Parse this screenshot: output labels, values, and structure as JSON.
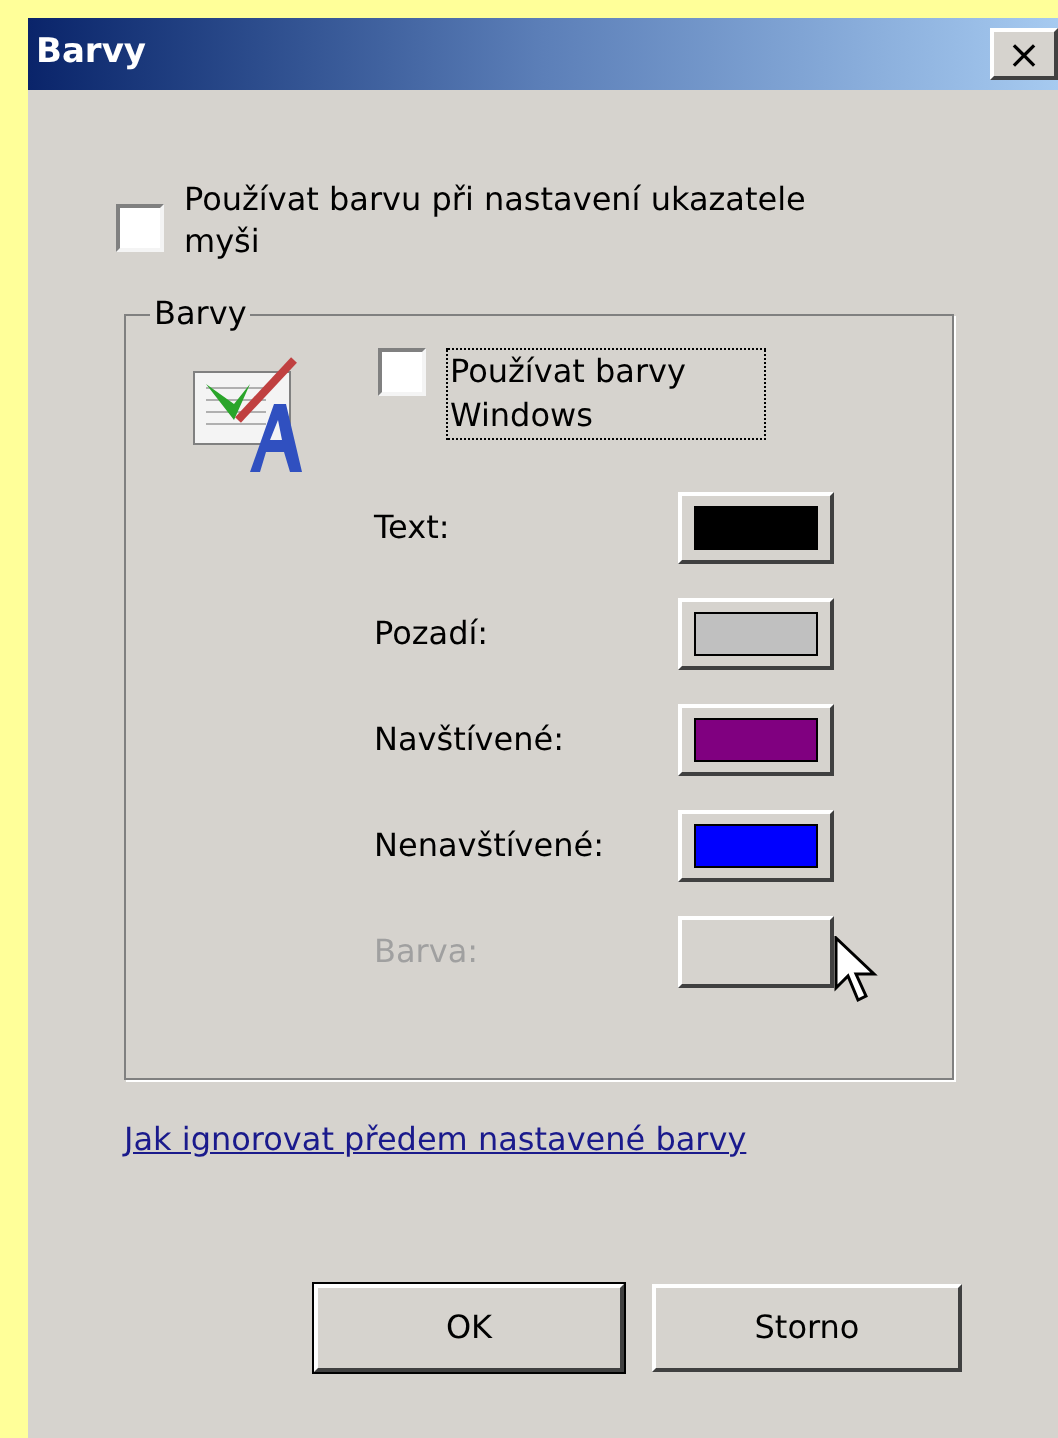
{
  "window": {
    "title": "Barvy",
    "close": "×"
  },
  "pointer_checkbox": {
    "label": "Používat barvu při nastavení ukazatele myši",
    "checked": false
  },
  "group": {
    "legend": "Barvy",
    "windows_checkbox": {
      "label": "Používat barvy Windows",
      "checked": false,
      "focused": true
    },
    "rows": [
      {
        "label": "Text:",
        "color": "#000000",
        "disabled": false
      },
      {
        "label": "Pozadí:",
        "color": "#c0c0c0",
        "disabled": false
      },
      {
        "label": "Navštívené:",
        "color": "#800080",
        "disabled": false
      },
      {
        "label": "Nenavštívené:",
        "color": "#0000ff",
        "disabled": false
      },
      {
        "label": "Barva:",
        "disabled": true
      }
    ]
  },
  "link": "Jak ignorovat předem nastavené barvy",
  "buttons": [
    {
      "label": "OK",
      "default": true
    },
    {
      "label": "Storno",
      "default": false
    }
  ]
}
